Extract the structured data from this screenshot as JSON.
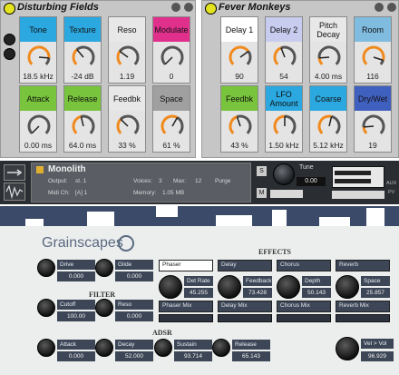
{
  "rack_left": {
    "title": "Disturbing Fields",
    "macros": [
      {
        "label": "Tone",
        "value": "18.5 kHz",
        "color": "#2ba8e0",
        "level": 0.85
      },
      {
        "label": "Texture",
        "value": "-24 dB",
        "color": "#2ba8e0",
        "level": 0.35
      },
      {
        "label": "Reso",
        "value": "1.19",
        "color": "#e8e8e8",
        "level": 0.3
      },
      {
        "label": "Modulate",
        "value": "0",
        "color": "#e0308c",
        "level": 0.0
      },
      {
        "label": "Attack",
        "value": "0.00 ms",
        "color": "#78c43c",
        "level": 0.0
      },
      {
        "label": "Release",
        "value": "64.0 ms",
        "color": "#78c43c",
        "level": 0.45
      },
      {
        "label": "Feedbk",
        "value": "33 %",
        "color": "#e8e8e8",
        "level": 0.33
      },
      {
        "label": "Space",
        "value": "61 %",
        "color": "#a0a0a0",
        "level": 0.61
      }
    ]
  },
  "rack_right": {
    "title": "Fever Monkeys",
    "macros": [
      {
        "label": "Delay 1",
        "value": "90",
        "color": "#ffffff",
        "level": 0.7
      },
      {
        "label": "Delay 2",
        "value": "54",
        "color": "#c8ccee",
        "level": 0.42
      },
      {
        "label": "Pitch Decay",
        "value": "4.00 ms",
        "color": "#e8e8e8",
        "level": 0.15
      },
      {
        "label": "Room",
        "value": "116",
        "color": "#80bce0",
        "level": 0.9
      },
      {
        "label": "Feedbk",
        "value": "43 %",
        "color": "#78c43c",
        "level": 0.43
      },
      {
        "label": "LFO Amount",
        "value": "1.50 kHz",
        "color": "#2ba8e0",
        "level": 0.5
      },
      {
        "label": "Coarse",
        "value": "5.12 kHz",
        "color": "#2ba8e0",
        "level": 0.55
      },
      {
        "label": "Dry/Wet",
        "value": "19",
        "color": "#4060c0",
        "level": 0.15
      }
    ]
  },
  "kontakt": {
    "instrument_name": "Monolith",
    "output_label": "Output:",
    "output_value": "st. 1",
    "voices_label": "Voices:",
    "voices_value": "3",
    "max_label": "Max:",
    "max_value": "12",
    "purge_label": "Purge",
    "midi_label": "Midi Ch:",
    "midi_value": "[A] 1",
    "memory_label": "Memory:",
    "memory_value": "1.05 MB",
    "tune_label": "Tune",
    "tune_value": "0.00",
    "solo_label": "S",
    "mute_label": "M",
    "aux_label": "AUX",
    "pv_label": "PV"
  },
  "grainscapes": {
    "logo": "Grainscapes",
    "sections": {
      "effects": "EFFECTS",
      "filter": "FILTER",
      "adsr": "ADSR"
    },
    "knobs": [
      {
        "label": "Drive",
        "value": "0.000"
      },
      {
        "label": "Glide",
        "value": "0.000"
      },
      {
        "label": "Cutoff",
        "value": "100.00"
      },
      {
        "label": "Reso",
        "value": "0.000"
      },
      {
        "label": "Attack",
        "value": "0.000"
      },
      {
        "label": "Decay",
        "value": "52.000"
      },
      {
        "label": "Sustain",
        "value": "93.714"
      },
      {
        "label": "Release",
        "value": "65.143"
      }
    ],
    "effects": [
      {
        "name": "Phaser",
        "param": "Det Rate",
        "value": "45.255",
        "mix": "Phaser Mix"
      },
      {
        "name": "Delay",
        "param": "Feedback",
        "value": "73.428",
        "mix": "Delay Mix"
      },
      {
        "name": "Chorus",
        "param": "Depth",
        "value": "50.143",
        "mix": "Chorus Mix"
      },
      {
        "name": "Reverb",
        "param": "Space",
        "value": "25.857",
        "mix": "Reverb Mix"
      }
    ],
    "velocity": {
      "label": "Vel > Vol",
      "value": "96.929"
    }
  }
}
